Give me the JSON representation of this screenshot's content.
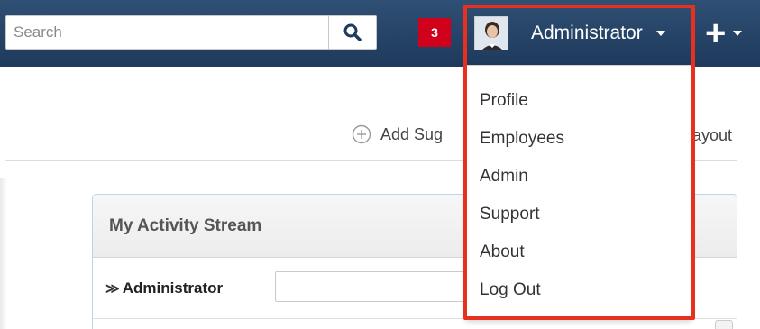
{
  "header": {
    "search_placeholder": "Search",
    "notification_count": "3",
    "user_name": "Administrator",
    "plus_label": "+"
  },
  "main": {
    "add_sugar_label": "Add Sug",
    "layout_label": "ayout"
  },
  "dashlet": {
    "title": "My Activity Stream",
    "user_label": "Administrator",
    "collapse_glyph": "≫"
  },
  "user_menu": {
    "items": [
      {
        "label": "Profile"
      },
      {
        "label": "Employees"
      },
      {
        "label": "Admin"
      },
      {
        "label": "Support"
      },
      {
        "label": "About"
      },
      {
        "label": "Log Out"
      }
    ]
  },
  "colors": {
    "topbar": "#1e3a5c",
    "badge": "#d0021b",
    "highlight": "#e8301f"
  }
}
